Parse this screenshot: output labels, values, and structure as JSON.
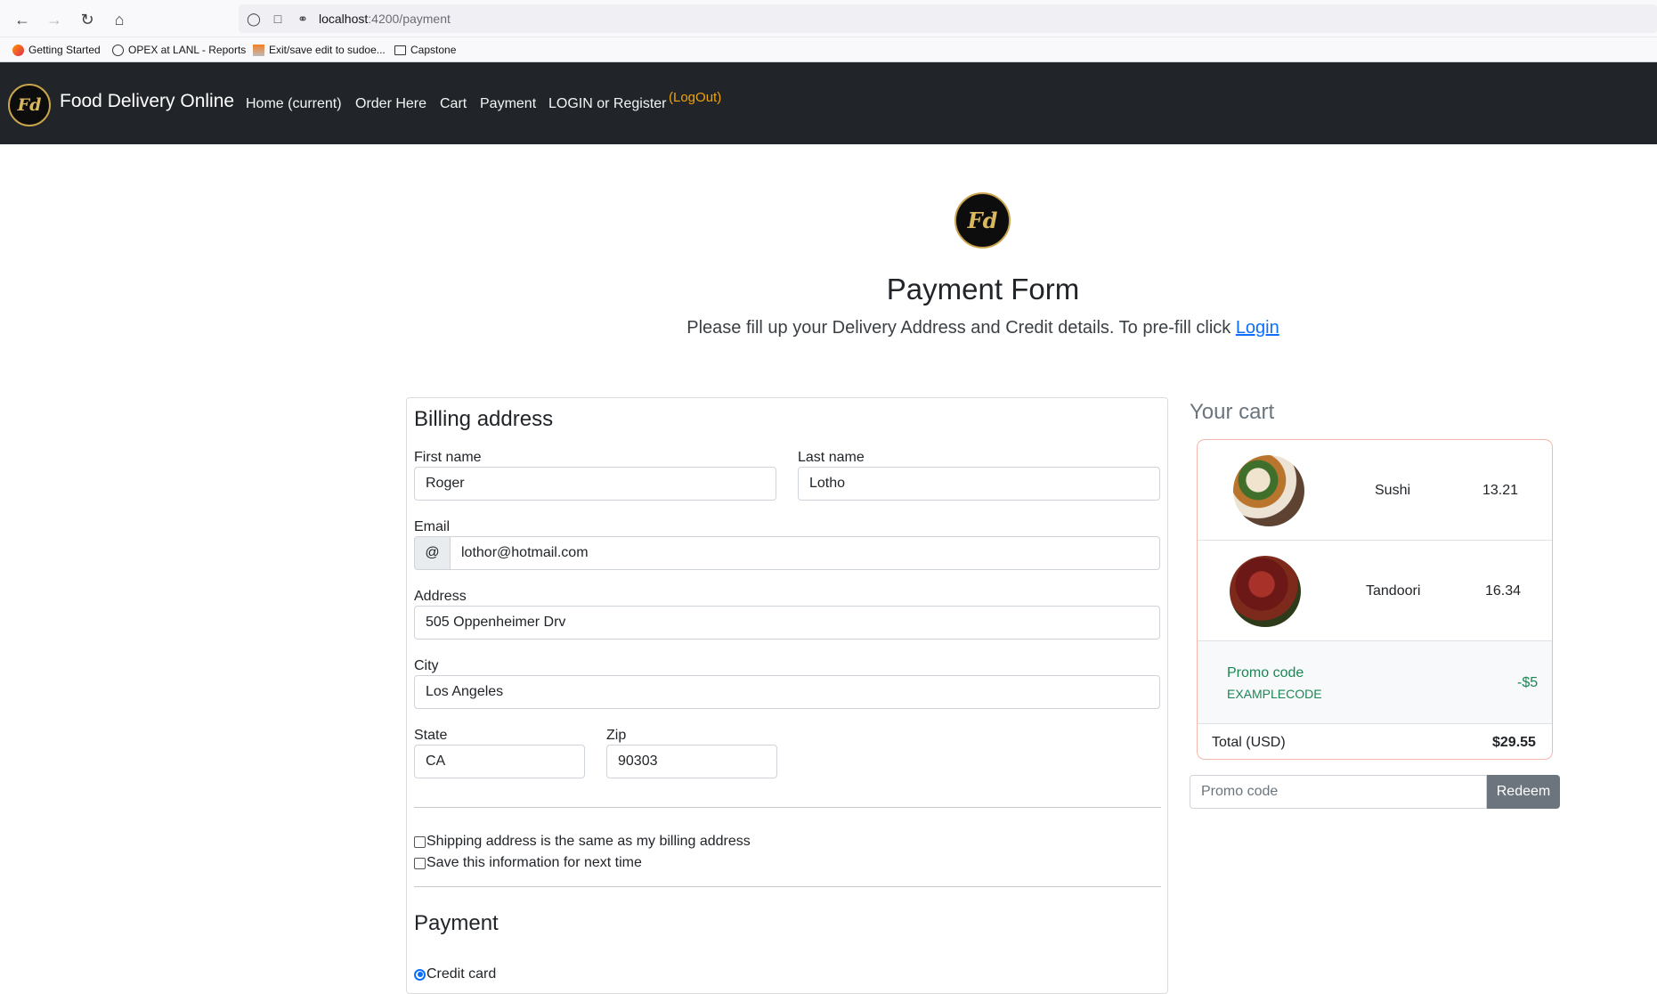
{
  "browser": {
    "url_host": "localhost",
    "url_path": ":4200/payment",
    "bookmarks": [
      "Getting Started",
      "OPEX at LANL - Reports",
      "Exit/save edit to sudoe...",
      "Capstone"
    ]
  },
  "navbar": {
    "brand": "Food Delivery Online",
    "logo_text": "Fd",
    "links": [
      "Home (current)",
      "Order Here",
      "Cart",
      "Payment",
      "LOGIN or Register"
    ],
    "logout": "(LogOut)"
  },
  "header": {
    "title": "Payment Form",
    "lead": "Please fill up your Delivery Address and Credit details. To pre-fill click ",
    "lead_link": "Login"
  },
  "billing": {
    "heading": "Billing address",
    "first_name_label": "First name",
    "first_name": "Roger",
    "last_name_label": "Last name",
    "last_name": "Lotho",
    "email_label": "Email",
    "email_prefix": "@",
    "email": "lothor@hotmail.com",
    "address_label": "Address",
    "address": "505 Oppenheimer Drv",
    "city_label": "City",
    "city": "Los Angeles",
    "state_label": "State",
    "state": "CA",
    "zip_label": "Zip",
    "zip": "90303",
    "same_address": "Shipping address is the same as my billing address",
    "save_info": "Save this information for next time",
    "payment_heading": "Payment",
    "credit_card": "Credit card"
  },
  "cart": {
    "heading": "Your cart",
    "items": [
      {
        "name": "Sushi",
        "price": "13.21"
      },
      {
        "name": "Tandoori",
        "price": "16.34"
      }
    ],
    "promo_title": "Promo code",
    "promo_code": "EXAMPLECODE",
    "promo_amount": "-$5",
    "total_label": "Total (USD)",
    "total": "$29.55",
    "promo_placeholder": "Promo code",
    "redeem": "Redeem"
  },
  "colors": {
    "navbar_bg": "#212529",
    "logout": "#f0a30a",
    "link": "#0d6efd",
    "promo": "#198754",
    "cart_border": "#f3b7ae",
    "redeem_bg": "#6c757d"
  }
}
